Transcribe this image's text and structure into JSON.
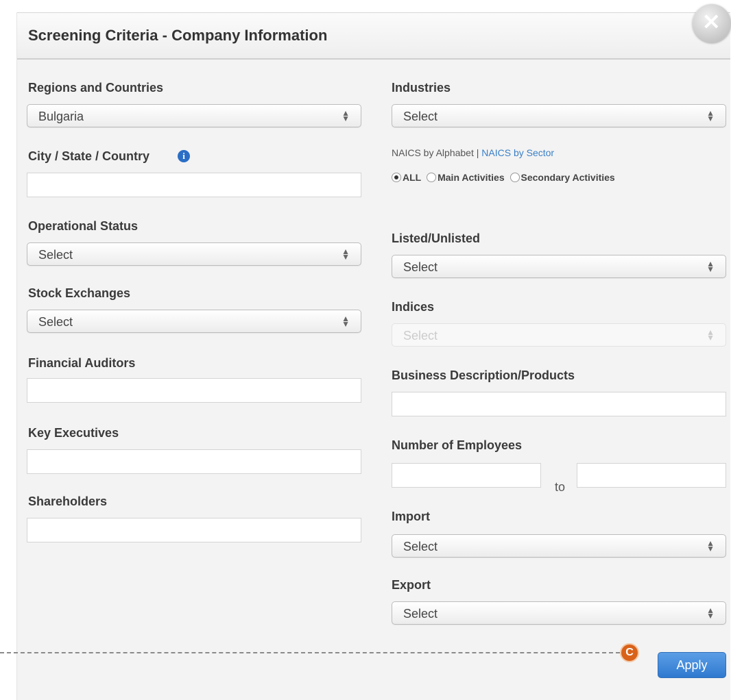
{
  "dialog": {
    "title": "Screening Criteria - Company Information",
    "close_glyph": "×"
  },
  "left": {
    "regions_label": "Regions and Countries",
    "regions_value": "Bulgaria",
    "city_label": "City / State / Country",
    "info_glyph": "i",
    "city_value": "",
    "operational_label": "Operational Status",
    "operational_value": "Select",
    "stock_label": "Stock Exchanges",
    "stock_value": "Select",
    "auditors_label": "Financial Auditors",
    "auditors_value": "",
    "executives_label": "Key Executives",
    "executives_value": "",
    "shareholders_label": "Shareholders",
    "shareholders_value": ""
  },
  "right": {
    "industries_label": "Industries",
    "industries_value": "Select",
    "naics_alpha": "NAICS by Alphabet",
    "naics_sep": " | ",
    "naics_sector": "NAICS by Sector",
    "radio_all": "ALL",
    "radio_main": "Main Activities",
    "radio_secondary": "Secondary Activities",
    "radio_selected": "ALL",
    "listed_label": "Listed/Unlisted",
    "listed_value": "Select",
    "indices_label": "Indices",
    "indices_value": "Select",
    "business_label": "Business Description/Products",
    "business_value": "",
    "employees_label": "Number of Employees",
    "employees_to": "to",
    "import_label": "Import",
    "import_value": "Select",
    "export_label": "Export",
    "export_value": "Select"
  },
  "footer": {
    "apply_label": "Apply",
    "callout_letter": "C"
  },
  "colors": {
    "accent": "#2f79cf",
    "link": "#3a7fc7",
    "callout": "#d9621a"
  },
  "icons": {
    "close": "close-icon",
    "info": "info-icon",
    "select_arrows": "up-down-arrows-icon"
  }
}
